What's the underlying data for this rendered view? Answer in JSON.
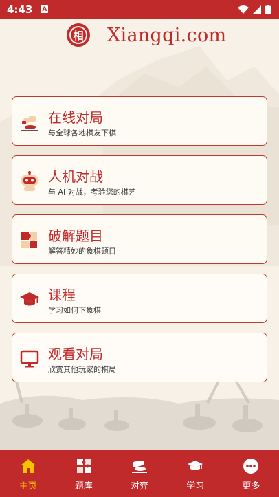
{
  "status_bar": {
    "time": "4:43",
    "notification_glyph": "A"
  },
  "brand": {
    "seal_char": "相",
    "name": "Xiangqi.com"
  },
  "menu": [
    {
      "icon": "hand-piece-icon",
      "title": "在线对局",
      "subtitle": "与全球各地棋友下棋"
    },
    {
      "icon": "robot-icon",
      "title": "人机对战",
      "subtitle": "与 AI 对战，考验您的棋艺"
    },
    {
      "icon": "puzzle-icon",
      "title": "破解题目",
      "subtitle": "解答精妙的象棋题目"
    },
    {
      "icon": "graduation-cap-icon",
      "title": "课程",
      "subtitle": "学习如何下象棋"
    },
    {
      "icon": "monitor-icon",
      "title": "观看对局",
      "subtitle": "欣赏其他玩家的棋局"
    }
  ],
  "bottom_nav": [
    {
      "icon": "home-icon",
      "label": "主页",
      "active": true
    },
    {
      "icon": "puzzle-icon",
      "label": "题库",
      "active": false
    },
    {
      "icon": "play-hand-icon",
      "label": "对弈",
      "active": false
    },
    {
      "icon": "graduation-cap-icon",
      "label": "学习",
      "active": false
    },
    {
      "icon": "more-icon",
      "label": "更多",
      "active": false
    }
  ],
  "colors": {
    "brand_red": "#c02a2a",
    "background": "#f8f1e7",
    "active_tab": "#f5c400"
  }
}
